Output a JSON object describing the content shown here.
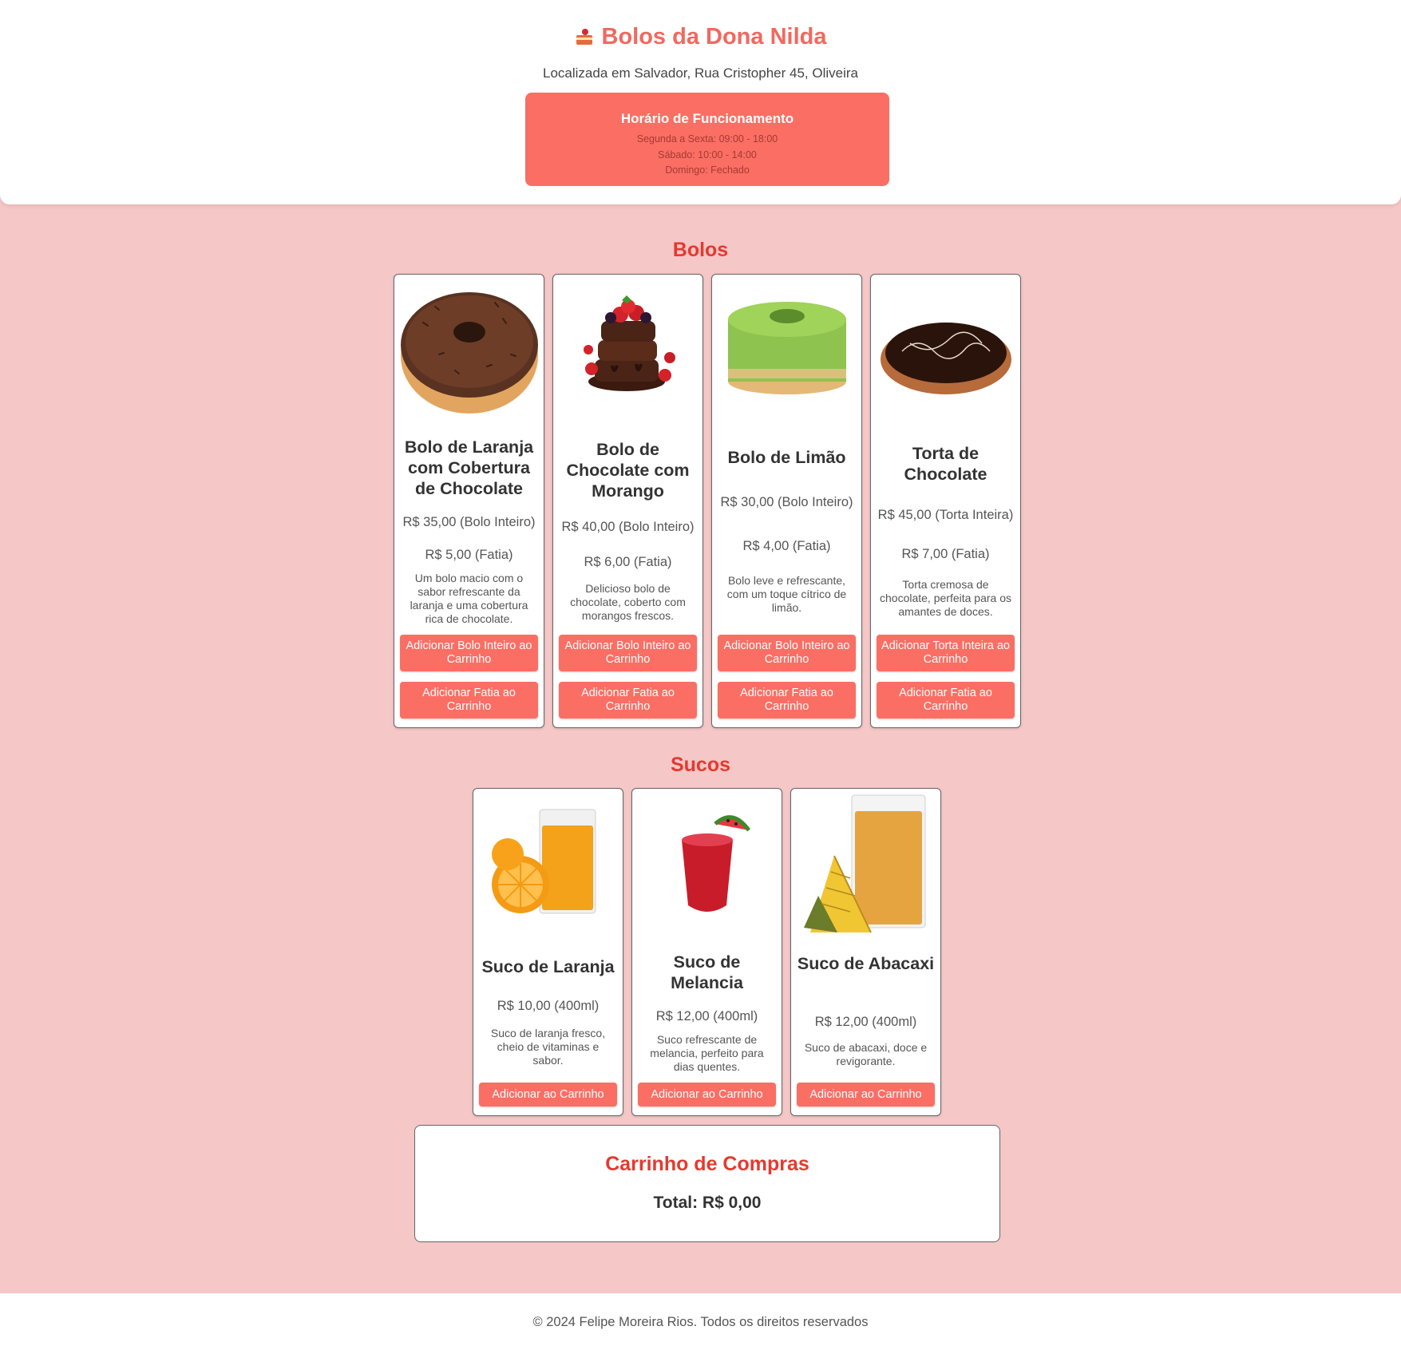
{
  "header": {
    "title": "Bolos da Dona Nilda",
    "address": "Localizada em Salvador, Rua Cristopher 45, Oliveira",
    "hours": {
      "title": "Horário de Funcionamento",
      "lines": [
        "Segunda a Sexta: 09:00 - 18:00",
        "Sábado: 10:00 - 14:00",
        "Domingo: Fechado"
      ]
    }
  },
  "bolos": {
    "title": "Bolos",
    "items": [
      {
        "name": "Bolo de Laranja com Cobertura de Chocolate",
        "price_whole": "R$ 35,00 (Bolo Inteiro)",
        "price_slice": "R$ 5,00 (Fatia)",
        "description": "Um bolo macio com o sabor refrescante da laranja e uma cobertura rica de chocolate.",
        "button_whole": "Adicionar Bolo Inteiro ao Carrinho",
        "button_slice": "Adicionar Fatia ao Carrinho",
        "image_icon": "chocolate-ring-cake-icon"
      },
      {
        "name": "Bolo de Chocolate com Morango",
        "price_whole": "R$ 40,00 (Bolo Inteiro)",
        "price_slice": "R$ 6,00 (Fatia)",
        "description": "Delicioso bolo de chocolate, coberto com morangos frescos.",
        "button_whole": "Adicionar Bolo Inteiro ao Carrinho",
        "button_slice": "Adicionar Fatia ao Carrinho",
        "image_icon": "strawberry-chocolate-cake-icon"
      },
      {
        "name": "Bolo de Limão",
        "price_whole": "R$ 30,00 (Bolo Inteiro)",
        "price_slice": "R$ 4,00 (Fatia)",
        "description": "Bolo leve e refrescante, com um toque cítrico de limão.",
        "button_whole": "Adicionar Bolo Inteiro ao Carrinho",
        "button_slice": "Adicionar Fatia ao Carrinho",
        "image_icon": "lime-cake-icon"
      },
      {
        "name": "Torta de Chocolate",
        "price_whole": "R$ 45,00 (Torta Inteira)",
        "price_slice": "R$ 7,00 (Fatia)",
        "description": "Torta cremosa de chocolate, perfeita para os amantes de doces.",
        "button_whole": "Adicionar Torta Inteira ao Carrinho",
        "button_slice": "Adicionar Fatia ao Carrinho",
        "image_icon": "chocolate-tart-icon"
      }
    ]
  },
  "sucos": {
    "title": "Sucos",
    "items": [
      {
        "name": "Suco de Laranja",
        "price": "R$ 10,00 (400ml)",
        "description": "Suco de laranja fresco, cheio de vitaminas e sabor.",
        "button": "Adicionar ao Carrinho",
        "image_icon": "orange-juice-icon"
      },
      {
        "name": "Suco de Melancia",
        "price": "R$ 12,00 (400ml)",
        "description": "Suco refrescante de melancia, perfeito para dias quentes.",
        "button": "Adicionar ao Carrinho",
        "image_icon": "watermelon-juice-icon"
      },
      {
        "name": "Suco de Abacaxi",
        "price": "R$ 12,00 (400ml)",
        "description": "Suco de abacaxi, doce e revigorante.",
        "button": "Adicionar ao Carrinho",
        "image_icon": "pineapple-juice-icon"
      }
    ]
  },
  "cart": {
    "title": "Carrinho de Compras",
    "total": "Total: R$ 0,00"
  },
  "footer": {
    "text": "© 2024 Felipe Moreira Rios. Todos os direitos reservados"
  },
  "colors": {
    "accent": "#fb6e64",
    "title_red": "#e5392f",
    "page_bg": "#f5c7c7"
  }
}
